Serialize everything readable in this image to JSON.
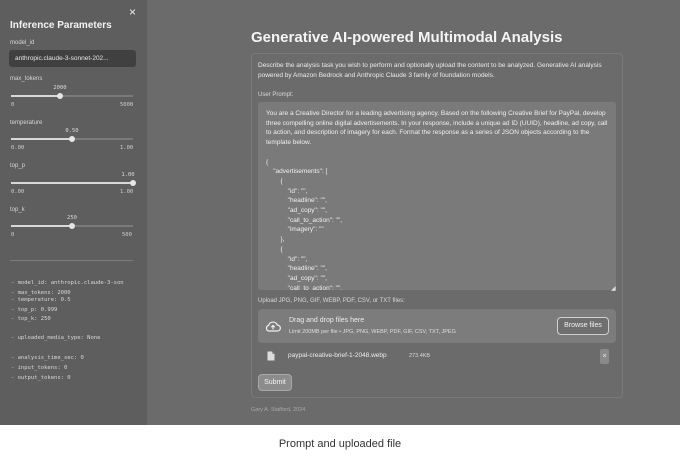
{
  "sidebar": {
    "close_glyph": "×",
    "title": "Inference Parameters",
    "model_id": {
      "label": "model_id",
      "value": "anthropic.claude-3-sonnet-202..."
    },
    "max_tokens": {
      "label": "max_tokens",
      "value": "2000",
      "min": "0",
      "max": "5000",
      "fraction": 0.4
    },
    "temperature": {
      "label": "temperature",
      "value": "0.50",
      "min": "0.00",
      "max": "1.00",
      "fraction": 0.5
    },
    "top_p": {
      "label": "top_p",
      "value": "1.00",
      "min": "0.00",
      "max": "1.00",
      "fraction": 1.0
    },
    "top_k": {
      "label": "top_k",
      "value": "250",
      "min": "0",
      "max": "500",
      "fraction": 0.5
    },
    "log": [
      "- model_id: anthropic.claude-3-son",
      "- max_tokens: 2000",
      "- temperature: 0.5",
      "- top_p: 0.999",
      "- top_k: 250",
      "- uploaded_media_type: None",
      "- analysis_time_sec: 0",
      "- input_tokens: 0",
      "- output_tokens: 0"
    ]
  },
  "main": {
    "title": "Generative AI-powered Multimodal Analysis",
    "description": "Describe the analysis task you wish to perform and optionally upload the content to be analyzed. Generative AI analysis powered by Amazon Bedrock and Anthropic Claude 3 family of foundation models.",
    "prompt_label": "User Prompt:",
    "prompt_text": "You are a Creative Director for a leading advertising agency. Based on the following Creative Brief for PayPal, develop three compelling online digital advertisements. In your response, include a unique ad ID (UUID), headline, ad copy, call to action, and description of imagery for each. Format the response as a series of JSON objects according to the template below.\n\n{\n    \"advertisements\": [\n        {\n            \"id\": \"\",\n            \"headline\": \"\",\n            \"ad_copy\": \"\",\n            \"call_to_action\": \"\",\n            \"imagery\": \"\"\n        },\n        {\n            \"id\": \"\",\n            \"headline\": \"\",\n            \"ad_copy\": \"\",\n            \"call_to_action\": \"\",",
    "upload_label": "Upload JPG, PNG, GIF, WEBP, PDF, CSV, or TXT files:",
    "drop_main": "Drag and drop files here",
    "drop_sub": "Limit 200MB per file • JPG, PNG, WEBP, PDF, GIF, CSV, TXT, JPEG",
    "browse_label": "Browse files",
    "file_name": "paypal-creative-brief-1-2048.webp",
    "file_size": "273.4KB",
    "file_remove_glyph": "×",
    "submit_label": "Submit",
    "footer": "Gary A. Stafford, 2024"
  },
  "caption": "Prompt and uploaded file",
  "icons": {
    "cloud": "cloud-upload-icon",
    "file": "file-icon",
    "close": "close-icon"
  }
}
